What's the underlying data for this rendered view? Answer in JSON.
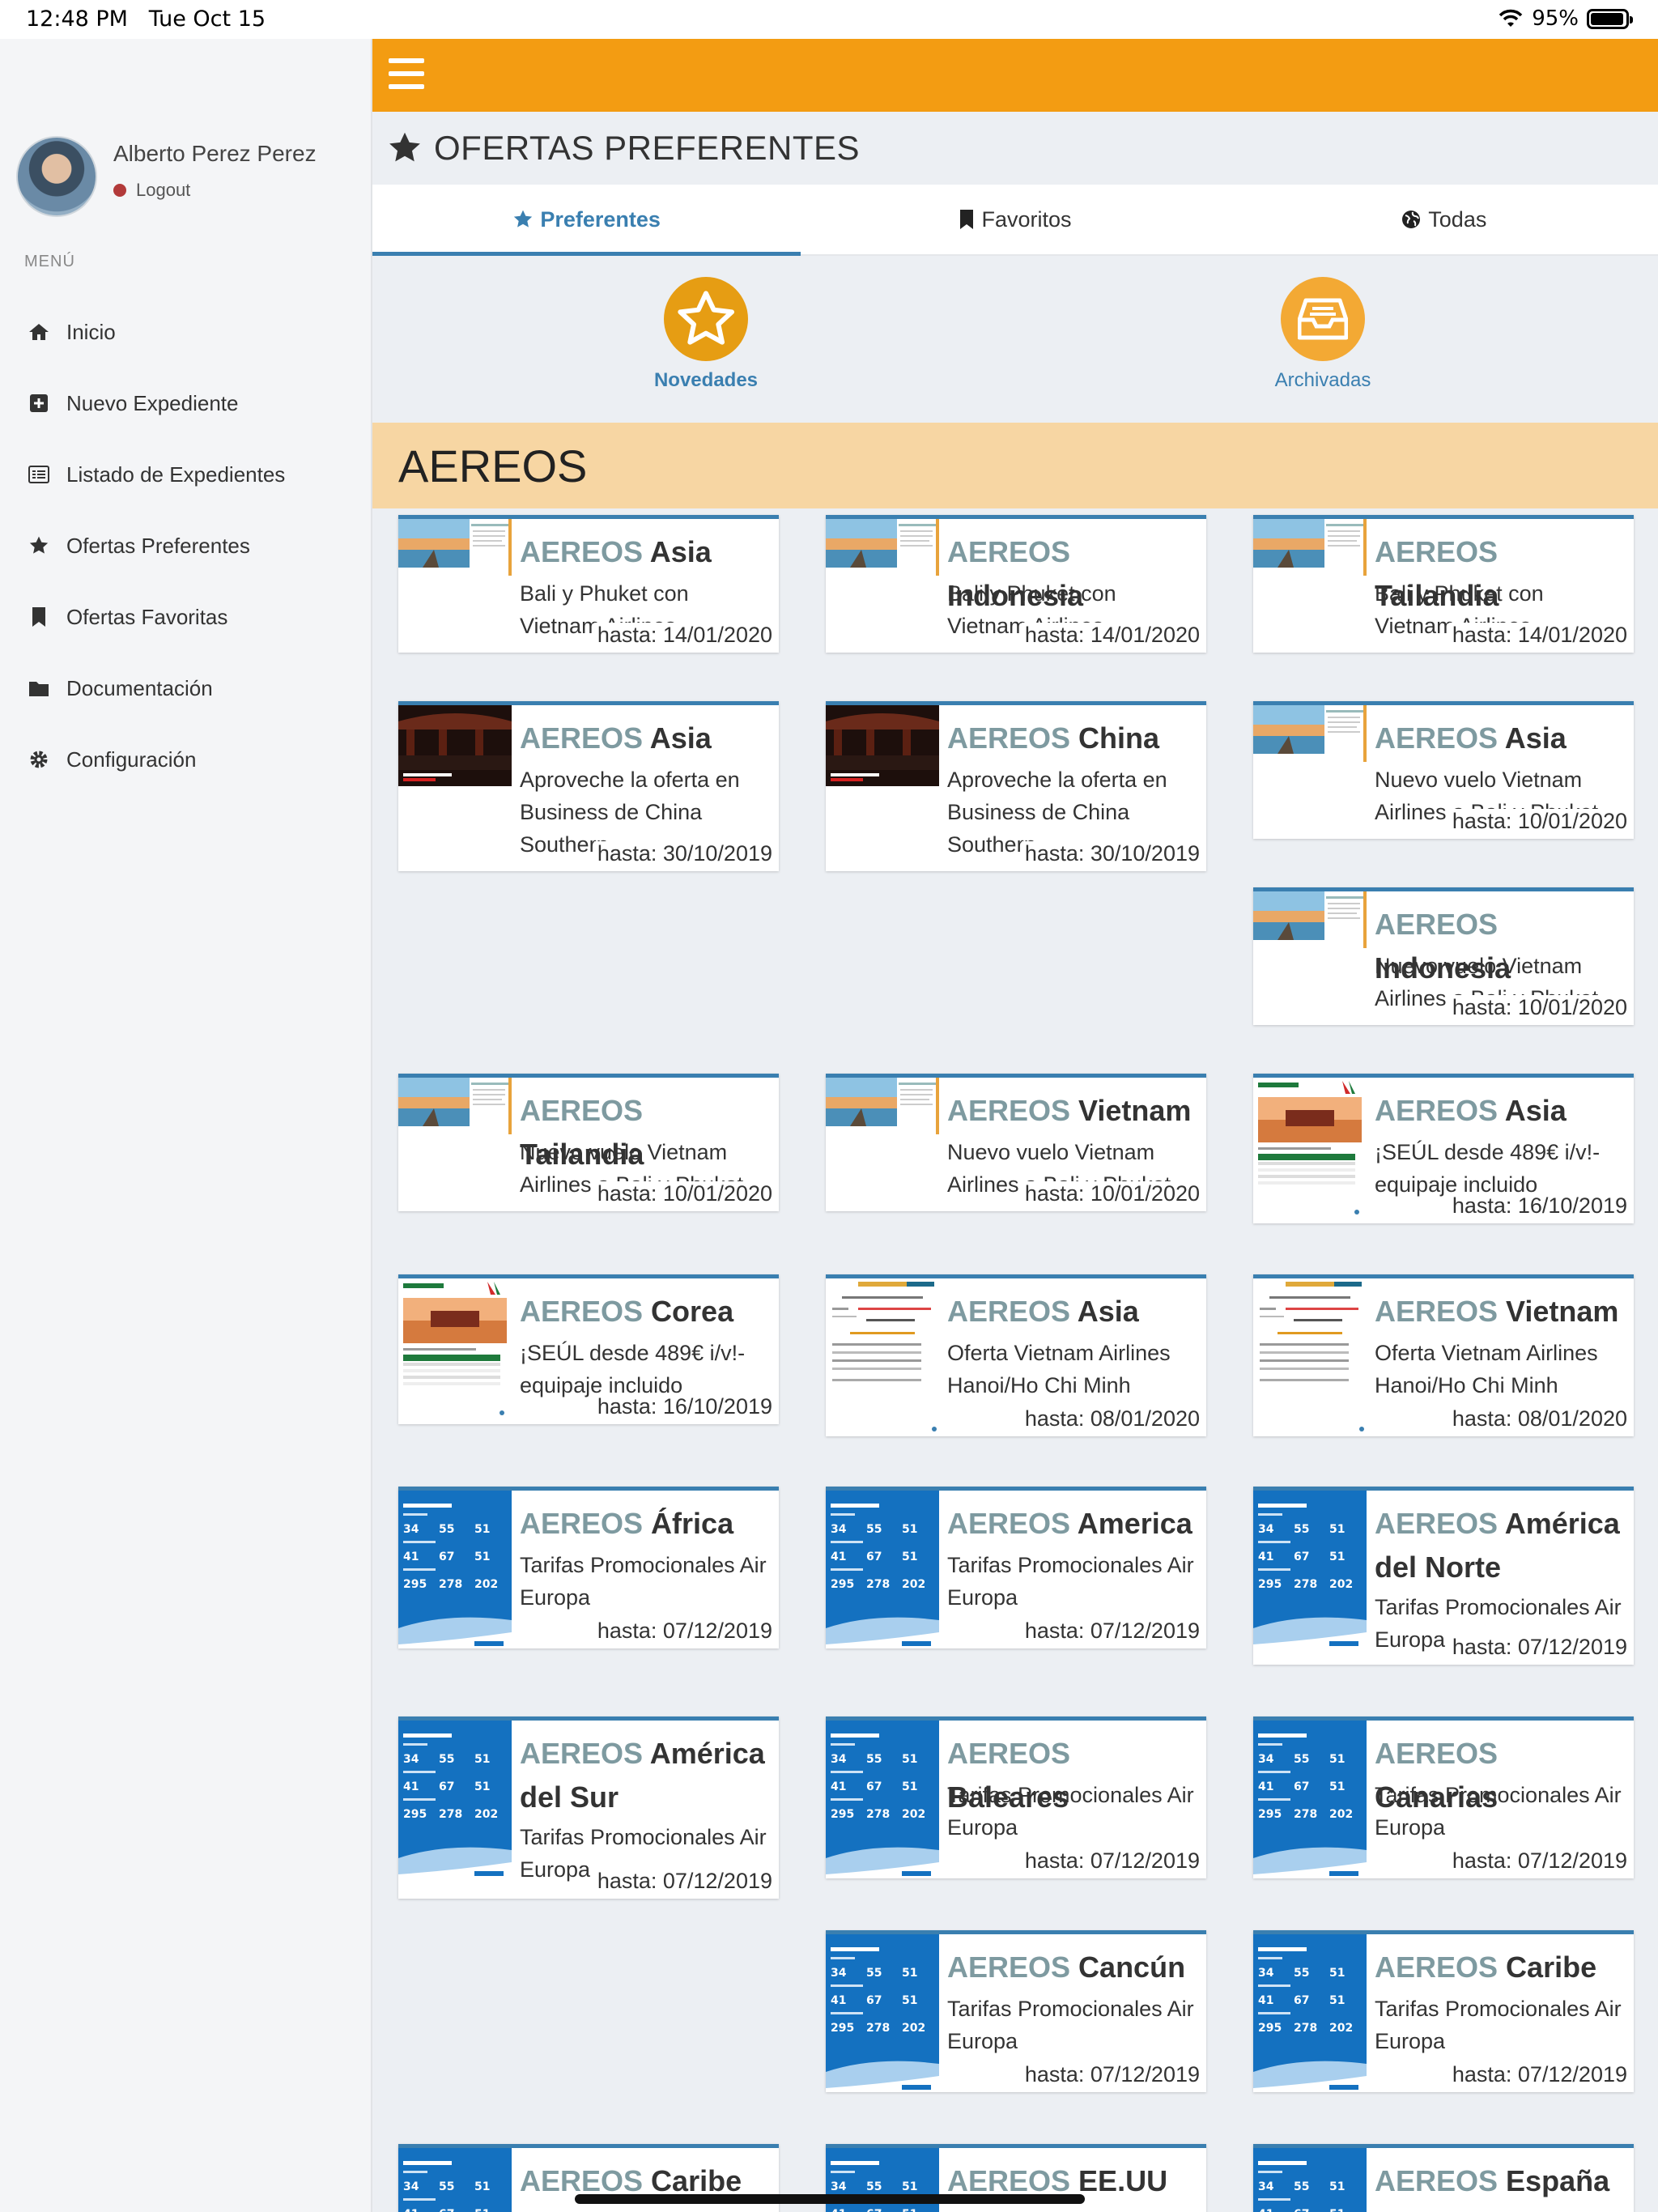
{
  "status": {
    "time": "12:48 PM",
    "date": "Tue Oct 15",
    "battery": "95%",
    "battery_level": 0.95
  },
  "profile": {
    "name": "Alberto Perez Perez",
    "logout": "Logout"
  },
  "menu": {
    "header": "MENÚ",
    "items": [
      {
        "label": "Inicio",
        "icon": "home-icon"
      },
      {
        "label": "Nuevo Expediente",
        "icon": "plus-square-icon"
      },
      {
        "label": "Listado de Expedientes",
        "icon": "list-icon"
      },
      {
        "label": "Ofertas Preferentes",
        "icon": "star-icon"
      },
      {
        "label": "Ofertas Favoritas",
        "icon": "bookmark-icon"
      },
      {
        "label": "Documentación",
        "icon": "folder-icon"
      },
      {
        "label": "Configuración",
        "icon": "gear-icon"
      }
    ]
  },
  "page": {
    "title": "OFERTAS PREFERENTES"
  },
  "tabs": [
    {
      "label": "Preferentes",
      "icon": "star-icon",
      "active": true
    },
    {
      "label": "Favoritos",
      "icon": "bookmark-icon",
      "active": false
    },
    {
      "label": "Todas",
      "icon": "globe-icon",
      "active": false
    }
  ],
  "filters": [
    {
      "label": "Novedades",
      "icon": "star-icon",
      "active": true
    },
    {
      "label": "Archivadas",
      "icon": "inbox-icon",
      "active": false
    }
  ],
  "section": {
    "title": "AEREOS"
  },
  "offers": [
    {
      "category": "AEREOS",
      "title": "Asia",
      "desc": "Bali y Phuket con Vietnam Airlines",
      "date": "hasta: 14/01/2020",
      "thumb": "beach"
    },
    {
      "category": "AEREOS",
      "title": "Indonesia",
      "desc": "Bali y Phuket con Vietnam Airlines",
      "date": "hasta: 14/01/2020",
      "thumb": "beach"
    },
    {
      "category": "AEREOS",
      "title": "Tailandia",
      "desc": "Bali y Phuket con Vietnam Airlines",
      "date": "hasta: 14/01/2020",
      "thumb": "beach"
    },
    {
      "category": "AEREOS",
      "title": "Asia",
      "desc": "Aproveche la oferta en Business de China Southern",
      "date": "hasta: 30/10/2019",
      "thumb": "china"
    },
    {
      "category": "AEREOS",
      "title": "China",
      "desc": "Aproveche la oferta en Business de China Southern",
      "date": "hasta: 30/10/2019",
      "thumb": "china"
    },
    {
      "category": "AEREOS",
      "title": "Asia",
      "desc": "Nuevo vuelo Vietnam Airlines a Bali y Phuket",
      "date": "hasta: 10/01/2020",
      "thumb": "beach"
    },
    {
      "category": "AEREOS",
      "title": "Indonesia",
      "desc": "Nuevo vuelo Vietnam Airlines a Bali y Phuket",
      "date": "hasta: 10/01/2020",
      "thumb": "beach"
    },
    {
      "category": "AEREOS",
      "title": "Tailandia",
      "desc": "Nuevo vuelo Vietnam Airlines a Bali y Phuket",
      "date": "hasta: 10/01/2020",
      "thumb": "beach"
    },
    {
      "category": "AEREOS",
      "title": "Vietnam",
      "desc": "Nuevo vuelo Vietnam Airlines a Bali y Phuket",
      "date": "hasta: 10/01/2020",
      "thumb": "beach"
    },
    {
      "category": "AEREOS",
      "title": "Asia",
      "desc": "¡SEÚL desde 489€ i/v!- equipaje incluido",
      "date": "hasta: 16/10/2019",
      "thumb": "alitalia"
    },
    {
      "category": "AEREOS",
      "title": "Corea",
      "desc": "¡SEÚL desde 489€ i/v!- equipaje incluido",
      "date": "hasta: 16/10/2019",
      "thumb": "alitalia"
    },
    {
      "category": "AEREOS",
      "title": "Asia",
      "desc": "Oferta Vietnam Airlines Hanoi/Ho Chi Minh",
      "date": "hasta: 08/01/2020",
      "thumb": "vietnam"
    },
    {
      "category": "AEREOS",
      "title": "Vietnam",
      "desc": "Oferta Vietnam Airlines Hanoi/Ho Chi Minh",
      "date": "hasta: 08/01/2020",
      "thumb": "vietnam"
    },
    {
      "category": "AEREOS",
      "title": "África",
      "desc": "Tarifas Promocionales Air Europa",
      "date": "hasta: 07/12/2019",
      "thumb": "aireuropa"
    },
    {
      "category": "AEREOS",
      "title": "America",
      "desc": "Tarifas Promocionales Air Europa",
      "date": "hasta: 07/12/2019",
      "thumb": "aireuropa"
    },
    {
      "category": "AEREOS",
      "title": "América del Norte",
      "desc": "Tarifas Promocionales Air Europa",
      "date": "hasta: 07/12/2019",
      "thumb": "aireuropa"
    },
    {
      "category": "AEREOS",
      "title": "América del Sur",
      "desc": "Tarifas Promocionales Air Europa",
      "date": "hasta: 07/12/2019",
      "thumb": "aireuropa"
    },
    {
      "category": "AEREOS",
      "title": "Baleares",
      "desc": "Tarifas Promocionales Air Europa",
      "date": "hasta: 07/12/2019",
      "thumb": "aireuropa"
    },
    {
      "category": "AEREOS",
      "title": "Canarias",
      "desc": "Tarifas Promocionales Air Europa",
      "date": "hasta: 07/12/2019",
      "thumb": "aireuropa"
    },
    {
      "category": "AEREOS",
      "title": "Cancún",
      "desc": "Tarifas Promocionales Air Europa",
      "date": "hasta: 07/12/2019",
      "thumb": "aireuropa"
    },
    {
      "category": "AEREOS",
      "title": "Caribe",
      "desc": "Tarifas Promocionales Air Europa",
      "date": "hasta: 07/12/2019",
      "thumb": "aireuropa"
    },
    {
      "category": "AEREOS",
      "title": "Caribe",
      "desc": "",
      "date": "",
      "thumb": "aireuropa"
    },
    {
      "category": "AEREOS",
      "title": "EE.UU",
      "desc": "",
      "date": "",
      "thumb": "aireuropa"
    },
    {
      "category": "AEREOS",
      "title": "España",
      "desc": "",
      "date": "",
      "thumb": "aireuropa"
    }
  ],
  "colors": {
    "accent": "#f39c12",
    "primary": "#3a7fb0",
    "section_bg": "#f7d6a3",
    "logout_dot": "#b23a3a"
  }
}
